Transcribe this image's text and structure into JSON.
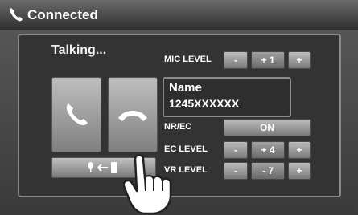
{
  "header": {
    "title": "Connected",
    "icon": "phone-icon"
  },
  "call": {
    "status": "Talking...",
    "contact_name": "Name",
    "contact_number": "1245XXXXXX"
  },
  "controls": {
    "mic_level": {
      "label": "MIC LEVEL",
      "minus": "-",
      "value": "+ 1",
      "plus": "+"
    },
    "nr_ec": {
      "label": "NR/EC",
      "value": "ON"
    },
    "ec_level": {
      "label": "EC LEVEL",
      "minus": "-",
      "value": "+ 4",
      "plus": "+"
    },
    "vr_level": {
      "label": "VR LEVEL",
      "minus": "-",
      "value": "- 7",
      "plus": "+"
    }
  },
  "buttons": {
    "answer": "phone-answer-icon",
    "hangup": "phone-hangup-icon",
    "transfer": "voice-transfer-icon"
  },
  "colors": {
    "accent": "#ffffff",
    "background": "#3a3a3a"
  }
}
